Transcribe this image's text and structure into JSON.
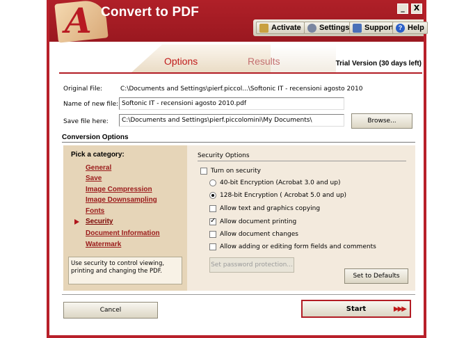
{
  "app": {
    "title": "Convert to PDF",
    "logo_letter": "A",
    "window_buttons": {
      "minimize": "_",
      "close": "X"
    }
  },
  "toolbar": {
    "activate": "Activate",
    "settings": "Settings",
    "support": "Support",
    "help": "Help"
  },
  "tabs": {
    "options": "Options",
    "results": "Results",
    "active": "Options"
  },
  "trial_text": "Trial Version (30 days left)",
  "files": {
    "original_label": "Original File:",
    "original_value": "C:\\Documents and Settings\\pierf.piccol...\\Softonic IT - recensioni agosto 2010",
    "new_name_label": "Name of new file:",
    "new_name_value": "Softonic IT - recensioni agosto 2010.pdf",
    "save_label": "Save file here:",
    "save_value": "C:\\Documents and Settings\\pierf.piccolomini\\My Documents\\",
    "browse_label": "Browse..."
  },
  "conversion": {
    "title": "Conversion Options",
    "pick_label": "Pick a category:",
    "categories": [
      "General",
      "Save",
      "Image Compression",
      "Image Downsampling",
      "Fonts",
      "Security",
      "Document Information",
      "Watermark"
    ],
    "selected": "Security",
    "description": "Use security to control viewing, printing and changing the PDF."
  },
  "security": {
    "title": "Security Options",
    "turn_on": {
      "label": "Turn on security",
      "checked": false
    },
    "enc_40": {
      "label": "40-bit Encryption (Acrobat 3.0 and up)",
      "selected": false
    },
    "enc_128": {
      "label": "128-bit Encryption ( Acrobat 5.0 and up)",
      "selected": true
    },
    "allow_copy": {
      "label": "Allow text and graphics copying",
      "checked": false
    },
    "allow_print": {
      "label": "Allow document printing",
      "checked": true
    },
    "allow_changes": {
      "label": "Allow document changes",
      "checked": false
    },
    "allow_forms": {
      "label": "Allow adding or editing form fields and comments",
      "checked": false
    },
    "set_password_label": "Set password protection...",
    "defaults_label": "Set to Defaults"
  },
  "footer": {
    "cancel_label": "Cancel",
    "start_label": "Start",
    "start_arrows": "▶▶▶"
  },
  "colors": {
    "brand_red": "#b8202a",
    "panel_tan": "#e6d5b8",
    "panel_light": "#f3eadd",
    "link_red": "#9a1a1a"
  }
}
